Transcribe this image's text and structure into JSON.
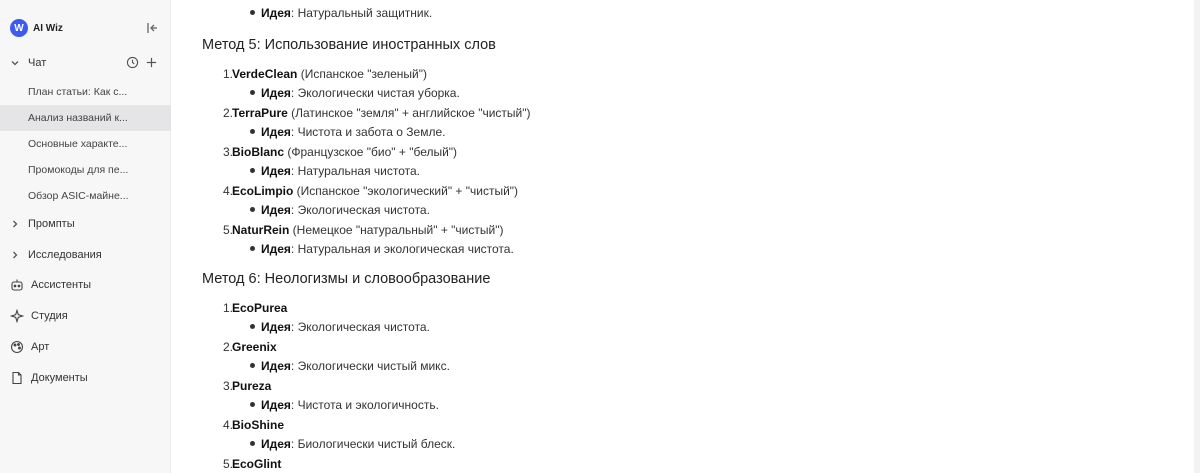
{
  "app": {
    "logo_letter": "W",
    "name": "AI Wiz"
  },
  "sidebar": {
    "chat_label": "Чат",
    "recent_chats": [
      "План статьи: Как с...",
      "Анализ названий к...",
      "Основные характе...",
      "Промокоды для пе...",
      "Обзор ASIC-майне..."
    ],
    "active_index": 1,
    "items": [
      {
        "label": "Промпты",
        "icon": "chevron-right-icon"
      },
      {
        "label": "Исследования",
        "icon": "chevron-right-icon"
      },
      {
        "label": "Ассистенты",
        "icon": "robot-icon"
      },
      {
        "label": "Студия",
        "icon": "sparkle-icon"
      },
      {
        "label": "Арт",
        "icon": "palette-icon"
      },
      {
        "label": "Документы",
        "icon": "document-icon"
      }
    ]
  },
  "content": {
    "idea_label": "Идея",
    "top_idea": ": Натуральный защитник.",
    "sections": [
      {
        "heading": "Метод 5: Использование иностранных слов",
        "items": [
          {
            "num": "1.",
            "name": "VerdeClean",
            "note": " (Испанское \"зеленый\")",
            "idea": ": Экологически чистая уборка."
          },
          {
            "num": "2.",
            "name": "TerraPure",
            "note": " (Латинское \"земля\" + английское \"чистый\")",
            "idea": ": Чистота и забота о Земле."
          },
          {
            "num": "3.",
            "name": "BioBlanc",
            "note": " (Французское \"био\" + \"белый\")",
            "idea": ": Натуральная чистота."
          },
          {
            "num": "4.",
            "name": "EcoLimpio",
            "note": " (Испанское \"экологический\" + \"чистый\")",
            "idea": ": Экологическая чистота."
          },
          {
            "num": "5.",
            "name": "NaturRein",
            "note": " (Немецкое \"натуральный\" + \"чистый\")",
            "idea": ": Натуральная и экологическая чистота."
          }
        ]
      },
      {
        "heading": "Метод 6: Неологизмы и словообразование",
        "items": [
          {
            "num": "1.",
            "name": "EcoPurea",
            "note": "",
            "idea": ": Экологическая чистота."
          },
          {
            "num": "2.",
            "name": "Greenix",
            "note": "",
            "idea": ": Экологически чистый микс."
          },
          {
            "num": "3.",
            "name": "Pureza",
            "note": "",
            "idea": ": Чистота и экологичность."
          },
          {
            "num": "4.",
            "name": "BioShine",
            "note": "",
            "idea": ": Биологически чистый блеск."
          },
          {
            "num": "5.",
            "name": "EcoGlint",
            "note": "",
            "idea": ""
          }
        ]
      }
    ]
  }
}
